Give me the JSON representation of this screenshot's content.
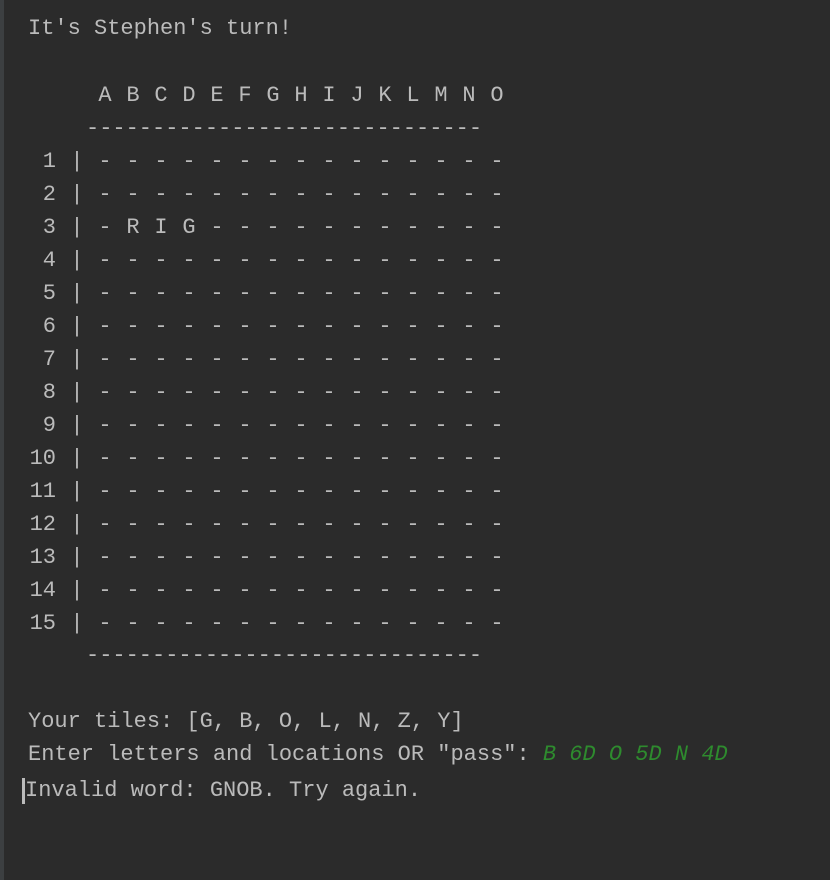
{
  "console": {
    "turn_message": "It's Stephen's turn!",
    "columns": [
      "A",
      "B",
      "C",
      "D",
      "E",
      "F",
      "G",
      "H",
      "I",
      "J",
      "K",
      "L",
      "M",
      "N",
      "O"
    ],
    "rule_top": "------------------------------",
    "rule_bottom": "------------------------------",
    "rows": [
      {
        "num": "1",
        "cells": [
          "-",
          "-",
          "-",
          "-",
          "-",
          "-",
          "-",
          "-",
          "-",
          "-",
          "-",
          "-",
          "-",
          "-",
          "-"
        ]
      },
      {
        "num": "2",
        "cells": [
          "-",
          "-",
          "-",
          "-",
          "-",
          "-",
          "-",
          "-",
          "-",
          "-",
          "-",
          "-",
          "-",
          "-",
          "-"
        ]
      },
      {
        "num": "3",
        "cells": [
          "-",
          "R",
          "I",
          "G",
          "-",
          "-",
          "-",
          "-",
          "-",
          "-",
          "-",
          "-",
          "-",
          "-",
          "-"
        ]
      },
      {
        "num": "4",
        "cells": [
          "-",
          "-",
          "-",
          "-",
          "-",
          "-",
          "-",
          "-",
          "-",
          "-",
          "-",
          "-",
          "-",
          "-",
          "-"
        ]
      },
      {
        "num": "5",
        "cells": [
          "-",
          "-",
          "-",
          "-",
          "-",
          "-",
          "-",
          "-",
          "-",
          "-",
          "-",
          "-",
          "-",
          "-",
          "-"
        ]
      },
      {
        "num": "6",
        "cells": [
          "-",
          "-",
          "-",
          "-",
          "-",
          "-",
          "-",
          "-",
          "-",
          "-",
          "-",
          "-",
          "-",
          "-",
          "-"
        ]
      },
      {
        "num": "7",
        "cells": [
          "-",
          "-",
          "-",
          "-",
          "-",
          "-",
          "-",
          "-",
          "-",
          "-",
          "-",
          "-",
          "-",
          "-",
          "-"
        ]
      },
      {
        "num": "8",
        "cells": [
          "-",
          "-",
          "-",
          "-",
          "-",
          "-",
          "-",
          "-",
          "-",
          "-",
          "-",
          "-",
          "-",
          "-",
          "-"
        ]
      },
      {
        "num": "9",
        "cells": [
          "-",
          "-",
          "-",
          "-",
          "-",
          "-",
          "-",
          "-",
          "-",
          "-",
          "-",
          "-",
          "-",
          "-",
          "-"
        ]
      },
      {
        "num": "10",
        "cells": [
          "-",
          "-",
          "-",
          "-",
          "-",
          "-",
          "-",
          "-",
          "-",
          "-",
          "-",
          "-",
          "-",
          "-",
          "-"
        ]
      },
      {
        "num": "11",
        "cells": [
          "-",
          "-",
          "-",
          "-",
          "-",
          "-",
          "-",
          "-",
          "-",
          "-",
          "-",
          "-",
          "-",
          "-",
          "-"
        ]
      },
      {
        "num": "12",
        "cells": [
          "-",
          "-",
          "-",
          "-",
          "-",
          "-",
          "-",
          "-",
          "-",
          "-",
          "-",
          "-",
          "-",
          "-",
          "-"
        ]
      },
      {
        "num": "13",
        "cells": [
          "-",
          "-",
          "-",
          "-",
          "-",
          "-",
          "-",
          "-",
          "-",
          "-",
          "-",
          "-",
          "-",
          "-",
          "-"
        ]
      },
      {
        "num": "14",
        "cells": [
          "-",
          "-",
          "-",
          "-",
          "-",
          "-",
          "-",
          "-",
          "-",
          "-",
          "-",
          "-",
          "-",
          "-",
          "-"
        ]
      },
      {
        "num": "15",
        "cells": [
          "-",
          "-",
          "-",
          "-",
          "-",
          "-",
          "-",
          "-",
          "-",
          "-",
          "-",
          "-",
          "-",
          "-",
          "-"
        ]
      }
    ],
    "row_separator": "|",
    "tiles_line": "Your tiles: [G, B, O, L, N, Z, Y]",
    "prompt": "Enter letters and locations OR \"pass\": ",
    "user_input": "B 6D O 5D N 4D",
    "error_message": "Invalid word: GNOB. Try again.",
    "colors": {
      "background": "#2b2b2b",
      "text": "#bbbbbb",
      "input": "#2e8b2e"
    }
  }
}
